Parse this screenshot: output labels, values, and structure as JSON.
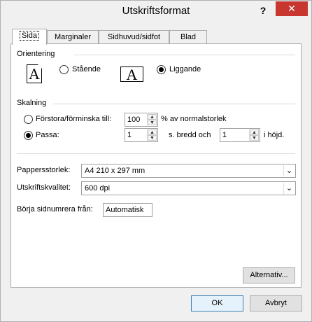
{
  "window": {
    "title": "Utskriftsformat",
    "help_label": "?",
    "close_label": "✕"
  },
  "tabs": [
    {
      "label": "Sida",
      "active": true
    },
    {
      "label": "Marginaler",
      "active": false
    },
    {
      "label": "Sidhuvud/sidfot",
      "active": false
    },
    {
      "label": "Blad",
      "active": false
    }
  ],
  "orientation": {
    "group_label": "Orientering",
    "portrait_label": "Stående",
    "landscape_label": "Liggande",
    "icon_letter": "A",
    "selected": "landscape"
  },
  "scaling": {
    "group_label": "Skalning",
    "adjust_label": "Förstora/förminska till:",
    "adjust_value": "100",
    "adjust_suffix": "% av normalstorlek",
    "fit_label": "Passa:",
    "fit_wide_value": "1",
    "fit_wide_suffix": "s. bredd och",
    "fit_tall_value": "1",
    "fit_tall_suffix": "i höjd.",
    "selected": "fit"
  },
  "paper_size": {
    "label": "Pappersstorlek:",
    "value": "A4 210 x 297 mm"
  },
  "print_quality": {
    "label": "Utskriftskvalitet:",
    "value": "600 dpi"
  },
  "first_page_number": {
    "label": "Börja sidnumrera från:",
    "value": "Automatisk"
  },
  "options_button": "Alternativ...",
  "ok_button": "OK",
  "cancel_button": "Avbryt"
}
